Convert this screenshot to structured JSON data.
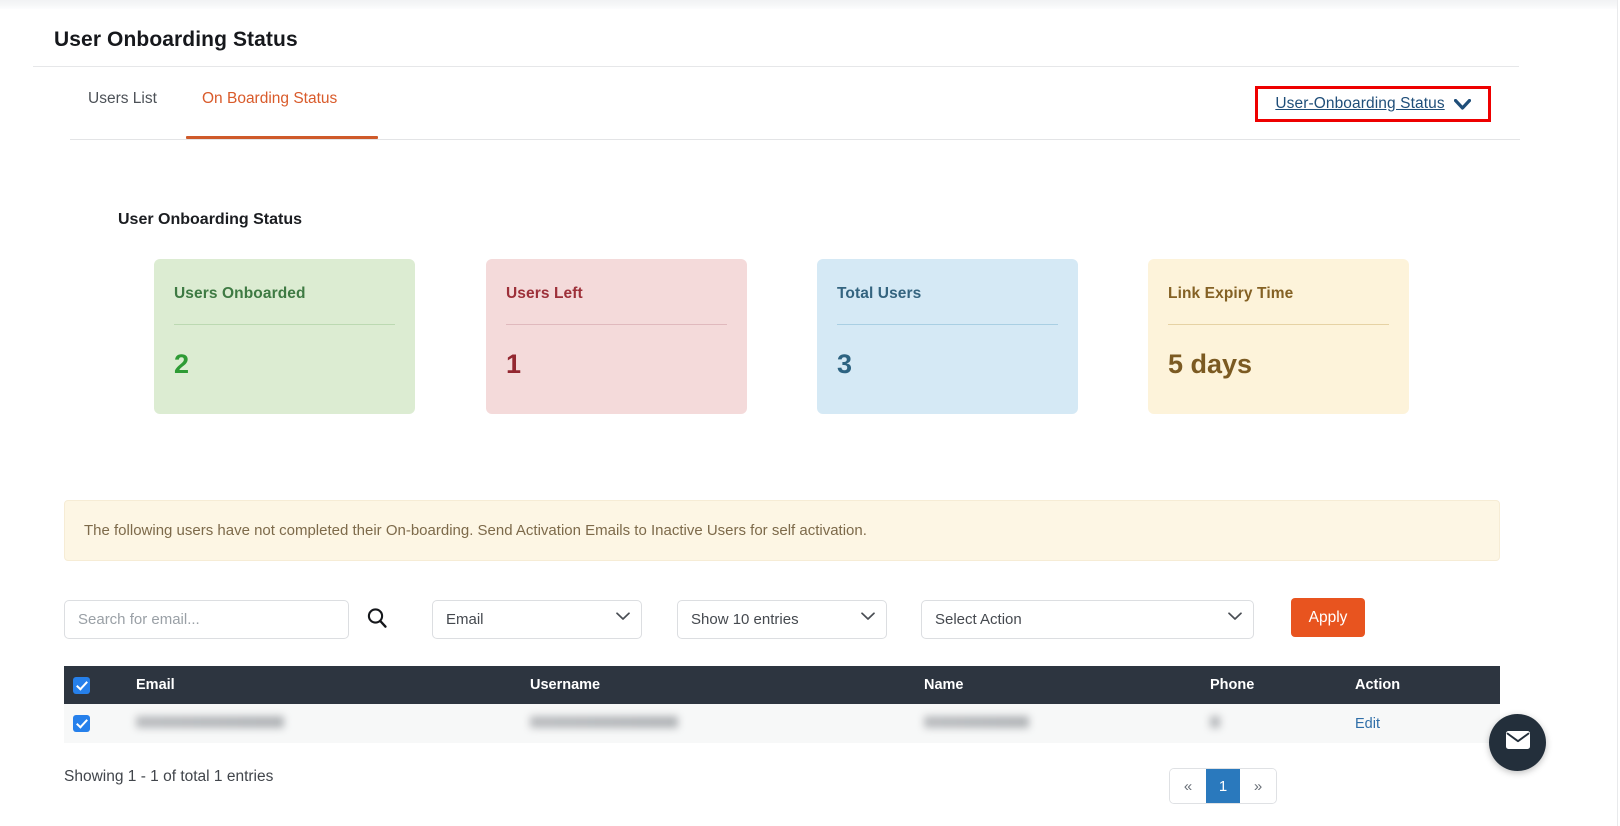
{
  "page": {
    "title": "User Onboarding Status"
  },
  "tabs": [
    {
      "label": "Users List",
      "active": false
    },
    {
      "label": "On Boarding Status",
      "active": true
    }
  ],
  "status_dropdown": {
    "label": "User-Onboarding Status",
    "icon": "chevron-down-icon",
    "highlight_color": "#ee0000"
  },
  "section": {
    "heading": "User Onboarding Status"
  },
  "cards": [
    {
      "title": "Users Onboarded",
      "value": "2",
      "color": "#dcecd2",
      "text_color": "#2e9b35"
    },
    {
      "title": "Users Left",
      "value": "1",
      "color": "#f4dada",
      "text_color": "#932730"
    },
    {
      "title": "Total Users",
      "value": "3",
      "color": "#d5e9f5",
      "text_color": "#2d6381"
    },
    {
      "title": "Link Expiry Time",
      "value": "5 days",
      "color": "#fdf3da",
      "text_color": "#7b5a22"
    }
  ],
  "alert": {
    "message": "The following users have not completed their On-boarding. Send Activation Emails to Inactive Users for self activation."
  },
  "toolbar": {
    "search_placeholder": "Search for email...",
    "search_value": "",
    "search_icon": "search-icon",
    "field_select": "Email",
    "entries_select": "Show 10 entries",
    "action_select": "Select Action",
    "apply_label": "Apply",
    "accent_color": "#e8541f"
  },
  "table": {
    "header_bg": "#2d3540",
    "select_all_checked": true,
    "columns": [
      "",
      "Email",
      "Username",
      "Name",
      "Phone",
      "Action"
    ],
    "rows": [
      {
        "checked": true,
        "email": "redacted",
        "username": "redacted",
        "name": "redacted",
        "phone": "redacted",
        "action": "Edit"
      }
    ]
  },
  "footer": {
    "showing": "Showing 1 - 1 of total 1 entries",
    "pagination": {
      "prev": "«",
      "pages": [
        "1"
      ],
      "next": "»",
      "active": "1",
      "active_color": "#2a79bd"
    }
  },
  "fab": {
    "icon": "envelope-icon",
    "color": "#232f3b"
  }
}
